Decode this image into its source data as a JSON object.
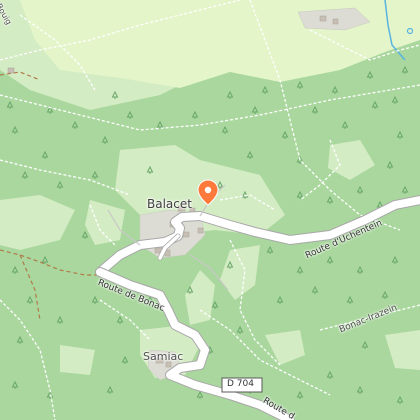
{
  "map": {
    "places": {
      "village_main": "Balacet",
      "hamlet": "Samiac",
      "locality": "Bonac-Irazein"
    },
    "roads": {
      "road_east": "Route d'Uchentein",
      "road_west": "Route de Bonac",
      "road_south_number": "D 704",
      "road_south_name_fragment": "Route d",
      "road_north_fragment": "Bouig"
    },
    "marker": {
      "icon": "map-pin-icon",
      "color": "#ff7a3a"
    },
    "colors": {
      "forest": "#a7d79b",
      "meadow": "#d4ecc4",
      "grassland": "#e2f5c8",
      "village": "#dcdcd4",
      "paths": "#ffffff",
      "trails": "#b07a4a",
      "water": "#5ab4df"
    }
  }
}
